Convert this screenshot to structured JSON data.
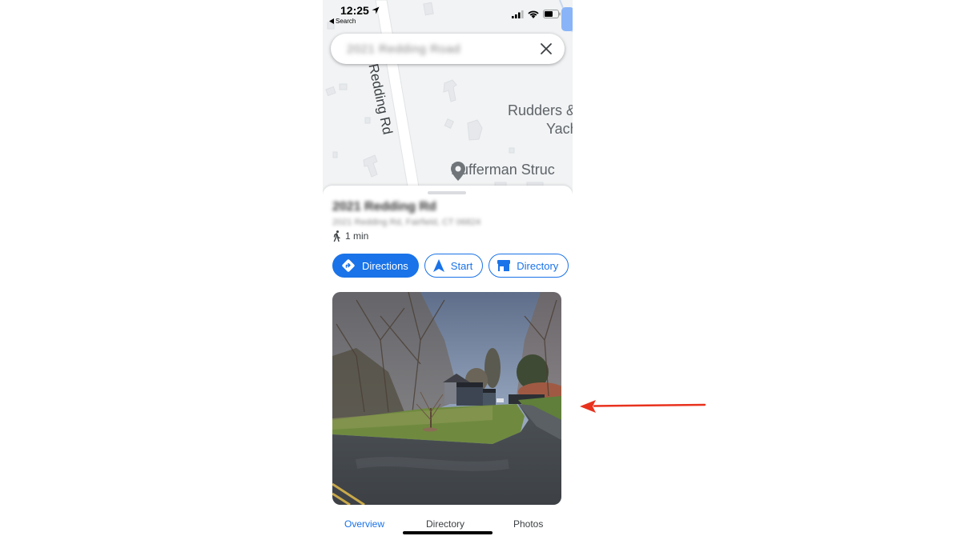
{
  "status_bar": {
    "time": "12:25",
    "back_label": "Search"
  },
  "search": {
    "query": "2021 Redding Road"
  },
  "map": {
    "road_label": "Redding Rd",
    "places": [
      "Rudders &",
      "Yach"
    ],
    "poi_label": "Kufferman Struc"
  },
  "place": {
    "title": "2021 Redding Rd",
    "address": "2021 Redding Rd, Fairfield, CT 06824",
    "walk_time": "1 min"
  },
  "actions": {
    "directions": "Directions",
    "start": "Start",
    "directory": "Directory"
  },
  "tabs": [
    {
      "label": "Overview",
      "active": true
    },
    {
      "label": "Directory",
      "active": false
    },
    {
      "label": "Photos",
      "active": false
    }
  ],
  "colors": {
    "accent": "#1a73e8",
    "annotation": "#e8321e"
  }
}
